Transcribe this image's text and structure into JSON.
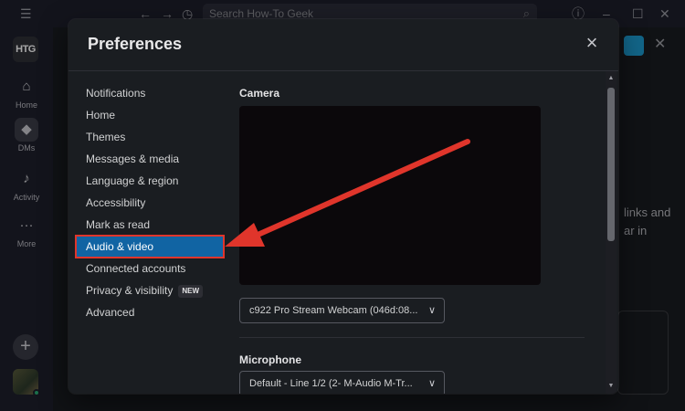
{
  "topbar": {
    "search_placeholder": "Search How-To Geek",
    "icons": [
      "menu-icon",
      "back-icon",
      "forward-icon",
      "history-icon",
      "search-icon",
      "help-icon",
      "minimize-icon",
      "maximize-icon",
      "close-icon"
    ]
  },
  "rail": {
    "workspace": "HTG",
    "items": [
      {
        "label": "Home",
        "icon": "home-icon"
      },
      {
        "label": "DMs",
        "icon": "dms-icon"
      },
      {
        "label": "Activity",
        "icon": "bell-icon"
      },
      {
        "label": "More",
        "icon": "more-icon"
      }
    ]
  },
  "background": {
    "line1": "links and",
    "line2": "ar in"
  },
  "preferences": {
    "title": "Preferences",
    "nav": [
      {
        "label": "Notifications"
      },
      {
        "label": "Home"
      },
      {
        "label": "Themes"
      },
      {
        "label": "Messages & media"
      },
      {
        "label": "Language & region"
      },
      {
        "label": "Accessibility"
      },
      {
        "label": "Mark as read"
      },
      {
        "label": "Audio & video",
        "selected": true
      },
      {
        "label": "Connected accounts"
      },
      {
        "label": "Privacy & visibility",
        "badge": "NEW"
      },
      {
        "label": "Advanced"
      }
    ],
    "camera": {
      "title": "Camera",
      "selected": "c922 Pro Stream Webcam (046d:08..."
    },
    "microphone": {
      "title": "Microphone",
      "selected": "Default - Line 1/2 (2- M-Audio M-Tr..."
    }
  },
  "colors": {
    "selected_nav": "#1164a3",
    "highlight_box": "#e0352b",
    "arrow": "#e0352b",
    "modal_bg": "#1a1d21"
  }
}
